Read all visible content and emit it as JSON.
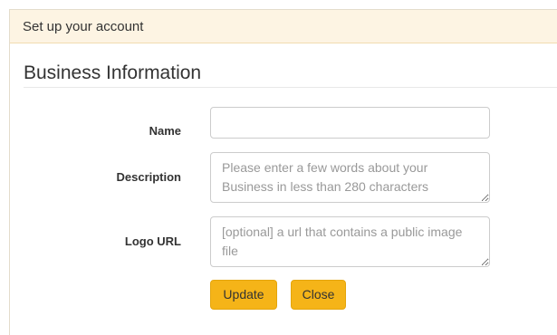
{
  "panel": {
    "heading": "Set up your account"
  },
  "form": {
    "section_title": "Business Information",
    "name": {
      "label": "Name",
      "value": "",
      "placeholder": ""
    },
    "description": {
      "label": "Description",
      "value": "",
      "placeholder": "Please enter a few words about your Business in less than 280 characters"
    },
    "logo_url": {
      "label": "Logo URL",
      "value": "",
      "placeholder": "[optional] a url that contains a public image file"
    },
    "buttons": {
      "update_label": "Update",
      "close_label": "Close"
    }
  },
  "colors": {
    "heading_background": "#fdf4e3",
    "button_background": "#f5b418"
  }
}
